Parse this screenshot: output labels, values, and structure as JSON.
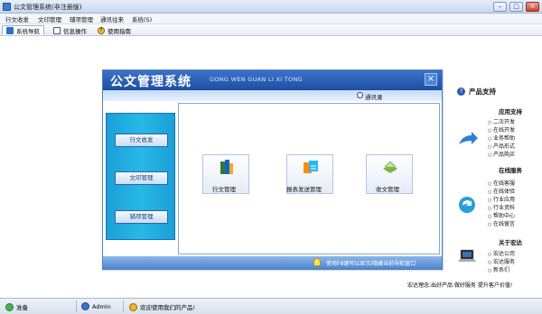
{
  "window": {
    "title": "公文管理系统(非注册版)",
    "btn_min": "–",
    "btn_max": "□",
    "btn_close": "×"
  },
  "menu": [
    "行文收发",
    "文印管理",
    "辅项管理",
    "通讯往来",
    "系统(S)"
  ],
  "tabs": [
    {
      "label": "系统导航"
    },
    {
      "label": "信息操作"
    },
    {
      "label": "使用指南"
    }
  ],
  "panel": {
    "title_cn": "公文管理系统",
    "title_py": "GONG WEN GUAN LI XI TONG",
    "address_book": "通讯录",
    "close": "×",
    "hint": "使用F8键可以显示/隐藏当前导航窗口"
  },
  "nav": [
    "行文收发",
    "文印管理",
    "辅项管理"
  ],
  "tiles": [
    {
      "label": "行文管理",
      "icon": "document-books-icon"
    },
    {
      "label": "报表发送管理",
      "icon": "report-send-icon"
    },
    {
      "label": "收文管理",
      "icon": "receive-tray-icon"
    }
  ],
  "right": {
    "support_title": "产品支持",
    "app_support": "应用支持",
    "app_links": [
      "二次开发",
      "在线开发",
      "业务帮助",
      "产品形式",
      "产品购买"
    ],
    "online_service": "在线服务",
    "online_links": [
      "在线客服",
      "在线体验",
      "行业应用",
      "行业资料",
      "帮助中心",
      "在线留言"
    ],
    "about": "关于宏达",
    "about_links": [
      "宏达公司",
      "宏达服务",
      "新系们"
    ],
    "motto": "宏达理念:出好产品 做好服务 提升客户价值!"
  },
  "status": {
    "ready": "准备",
    "user": "Admin",
    "welcome": "欢迎使用我们的产品!"
  },
  "colors": {
    "brand_blue": "#1c4ea4",
    "nav_cyan": "#27b9e6",
    "close_red": "#c8452f"
  }
}
